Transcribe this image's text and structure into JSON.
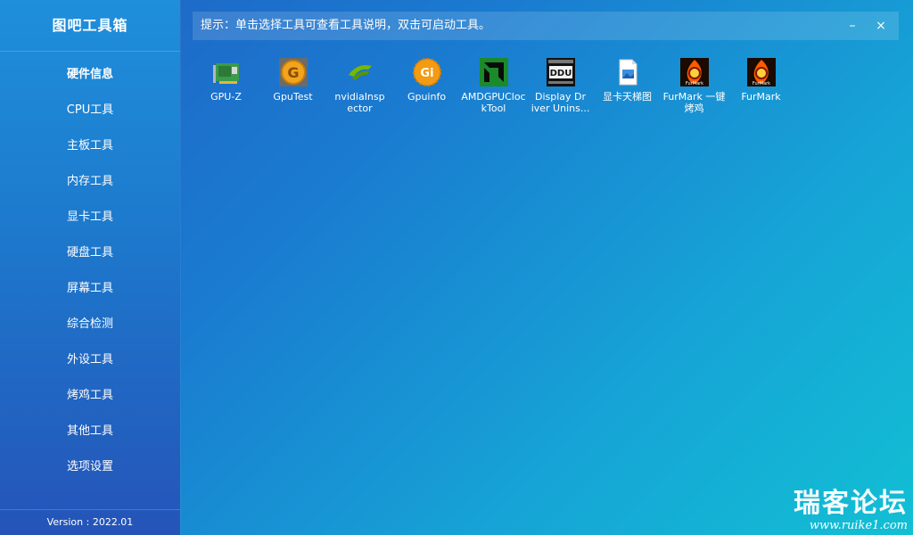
{
  "app": {
    "title": "图吧工具箱",
    "version": "Version : 2022.01"
  },
  "sidebar": {
    "items": [
      {
        "label": "硬件信息",
        "active": true
      },
      {
        "label": "CPU工具",
        "active": false
      },
      {
        "label": "主板工具",
        "active": false
      },
      {
        "label": "内存工具",
        "active": false
      },
      {
        "label": "显卡工具",
        "active": false
      },
      {
        "label": "硬盘工具",
        "active": false
      },
      {
        "label": "屏幕工具",
        "active": false
      },
      {
        "label": "综合检测",
        "active": false
      },
      {
        "label": "外设工具",
        "active": false
      },
      {
        "label": "烤鸡工具",
        "active": false
      },
      {
        "label": "其他工具",
        "active": false
      },
      {
        "label": "选项设置",
        "active": false
      }
    ]
  },
  "hint": {
    "text": "提示：单击选择工具可查看工具说明，双击可启动工具。"
  },
  "window": {
    "minimize": "–",
    "close": "×"
  },
  "tools": [
    {
      "label": "GPU-Z",
      "icon": "gpuz-icon"
    },
    {
      "label": "GpuTest",
      "icon": "gputest-icon"
    },
    {
      "label": "nvidiaInsp\nector",
      "icon": "nvidia-icon"
    },
    {
      "label": "Gpuinfo",
      "icon": "gpuinfo-icon",
      "icon_text": "Gi"
    },
    {
      "label": "AMDGPUCloc\nkTool",
      "icon": "amd-icon"
    },
    {
      "label": "Display Dr\niver Unins...",
      "icon": "ddu-icon",
      "icon_text": "DDU"
    },
    {
      "label": "显卡天梯图",
      "icon": "image-file-icon"
    },
    {
      "label": "FurMark 一键\n烤鸡",
      "icon": "furmark-icon",
      "icon_text": "FurMark"
    },
    {
      "label": "FurMark",
      "icon": "furmark-icon",
      "icon_text": "FurMark"
    }
  ],
  "watermark": {
    "title": "瑞客论坛",
    "url": "www.ruike1.com"
  },
  "colors": {
    "bg_start": "#1f62c4",
    "bg_end": "#12bfd4",
    "sidebar_top": "#1f8fdb",
    "sidebar_bottom": "#2554b8"
  }
}
